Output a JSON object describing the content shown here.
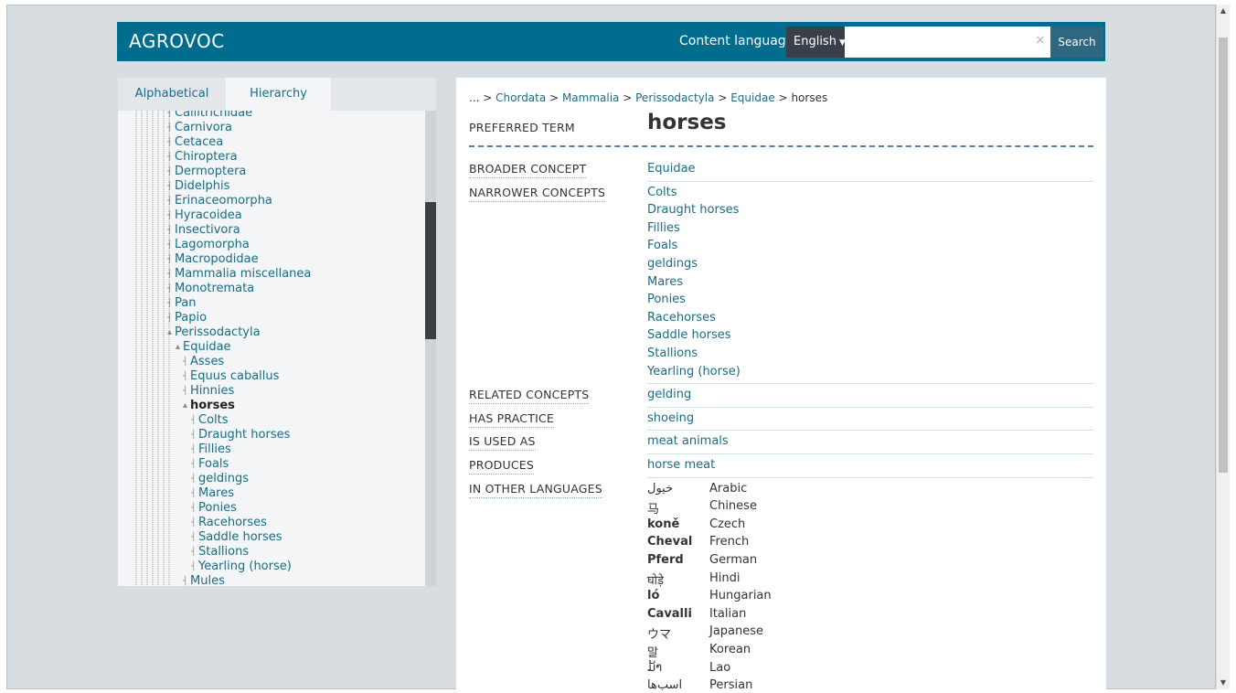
{
  "header": {
    "logo": "AGROVOC",
    "content_language_label": "Content language",
    "language_selected": "English",
    "search_value": "",
    "clear_symbol": "×",
    "search_label": "Search"
  },
  "tabs": [
    "Alphabetical",
    "Hierarchy"
  ],
  "tree": [
    {
      "label": "Callitrichidae",
      "depth": 3
    },
    {
      "label": "Carnivora",
      "depth": 3
    },
    {
      "label": "Cetacea",
      "depth": 3
    },
    {
      "label": "Chiroptera",
      "depth": 3
    },
    {
      "label": "Dermoptera",
      "depth": 3
    },
    {
      "label": "Didelphis",
      "depth": 3
    },
    {
      "label": "Erinaceomorpha",
      "depth": 3
    },
    {
      "label": "Hyracoidea",
      "depth": 3
    },
    {
      "label": "Insectivora",
      "depth": 3
    },
    {
      "label": "Lagomorpha",
      "depth": 3
    },
    {
      "label": "Macropodidae",
      "depth": 3
    },
    {
      "label": "Mammalia miscellanea",
      "depth": 3
    },
    {
      "label": "Monotremata",
      "depth": 3
    },
    {
      "label": "Pan",
      "depth": 3
    },
    {
      "label": "Papio",
      "depth": 3
    },
    {
      "label": "Perissodactyla",
      "depth": 3,
      "expanded": true
    },
    {
      "label": "Equidae",
      "depth": 4,
      "expanded": true
    },
    {
      "label": "Asses",
      "depth": 5
    },
    {
      "label": "Equus caballus",
      "depth": 5
    },
    {
      "label": "Hinnies",
      "depth": 5
    },
    {
      "label": "horses",
      "depth": 5,
      "expanded": true,
      "current": true
    },
    {
      "label": "Colts",
      "depth": 6
    },
    {
      "label": "Draught horses",
      "depth": 6
    },
    {
      "label": "Fillies",
      "depth": 6
    },
    {
      "label": "Foals",
      "depth": 6
    },
    {
      "label": "geldings",
      "depth": 6
    },
    {
      "label": "Mares",
      "depth": 6
    },
    {
      "label": "Ponies",
      "depth": 6
    },
    {
      "label": "Racehorses",
      "depth": 6
    },
    {
      "label": "Saddle horses",
      "depth": 6
    },
    {
      "label": "Stallions",
      "depth": 6
    },
    {
      "label": "Yearling (horse)",
      "depth": 6
    },
    {
      "label": "Mules",
      "depth": 5
    }
  ],
  "breadcrumb": {
    "prefix": "... >",
    "items": [
      "Chordata",
      "Mammalia",
      "Perissodactyla",
      "Equidae"
    ],
    "separator": ">",
    "current": "horses"
  },
  "concept": {
    "preferred_label": "PREFERRED TERM",
    "preferred_term": "horses",
    "properties": [
      {
        "label": "BROADER CONCEPT",
        "values": [
          "Equidae"
        ]
      },
      {
        "label": "NARROWER CONCEPTS",
        "values": [
          "Colts",
          "Draught horses",
          "Fillies",
          "Foals",
          "geldings",
          "Mares",
          "Ponies",
          "Racehorses",
          "Saddle horses",
          "Stallions",
          "Yearling (horse)"
        ]
      },
      {
        "label": "RELATED CONCEPTS",
        "values": [
          "gelding"
        ]
      },
      {
        "label": "HAS PRACTICE",
        "values": [
          "shoeing"
        ]
      },
      {
        "label": "IS USED AS",
        "values": [
          "meat animals"
        ]
      },
      {
        "label": "PRODUCES",
        "values": [
          "horse meat"
        ]
      }
    ],
    "other_languages_label": "IN OTHER LANGUAGES",
    "other_languages": [
      {
        "term": "خيول",
        "lang": "Arabic",
        "bold": false
      },
      {
        "term": "马",
        "lang": "Chinese",
        "bold": false
      },
      {
        "term": "koně",
        "lang": "Czech",
        "bold": true
      },
      {
        "term": "Cheval",
        "lang": "French",
        "bold": true
      },
      {
        "term": "Pferd",
        "lang": "German",
        "bold": true
      },
      {
        "term": "घोड़े",
        "lang": "Hindi",
        "bold": false
      },
      {
        "term": "ló",
        "lang": "Hungarian",
        "bold": true
      },
      {
        "term": "Cavalli",
        "lang": "Italian",
        "bold": true
      },
      {
        "term": "ウマ",
        "lang": "Japanese",
        "bold": false
      },
      {
        "term": "말",
        "lang": "Korean",
        "bold": false
      },
      {
        "term": "ມ້າ",
        "lang": "Lao",
        "bold": false
      },
      {
        "term": "اسب‌ها",
        "lang": "Persian",
        "bold": false
      }
    ]
  },
  "colors": {
    "header_bg": "#006d8f",
    "link": "#1c6b85",
    "page_bg": "#d8dde1"
  }
}
